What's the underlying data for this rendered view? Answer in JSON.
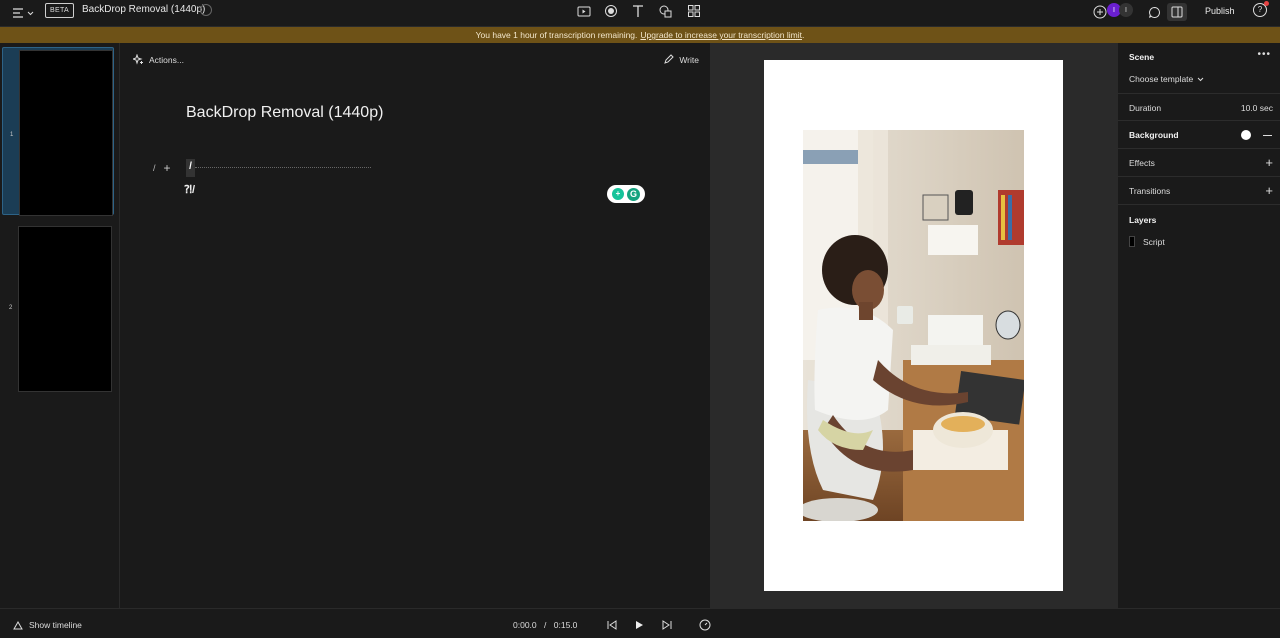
{
  "topbar": {
    "beta_label": "BETA",
    "doc_title": "BackDrop Removal (1440p)",
    "publish_label": "Publish",
    "avatar1": "I",
    "avatar2": "I",
    "help": "?"
  },
  "banner": {
    "message": "You have 1 hour of transcription remaining.",
    "link_text": "Upgrade to increase your transcription limit",
    "suffix": "."
  },
  "scenes": [
    {
      "number": "1"
    },
    {
      "number": "2"
    }
  ],
  "editor": {
    "actions_label": "Actions...",
    "write_label": "Write",
    "title": "BackDrop Removal (1440p)",
    "line_marker": "/",
    "line_plus": "+",
    "slash": "/",
    "cursor_text": "⁈/"
  },
  "properties": {
    "scene_label": "Scene",
    "template_label": "Choose template",
    "duration_label": "Duration",
    "duration_value": "10.0 sec",
    "background_label": "Background",
    "effects_label": "Effects",
    "transitions_label": "Transitions",
    "layers_label": "Layers",
    "layer_item": "Script"
  },
  "bottom": {
    "show_timeline": "Show timeline",
    "current_time": "0:00.0",
    "separator": "/",
    "total_time": "0:15.0"
  },
  "colors": {
    "banner_bg": "#6e5217",
    "active_scene": "#1b3d55",
    "avatar": "#6a1fd0",
    "grammarly": "#15c39a"
  }
}
